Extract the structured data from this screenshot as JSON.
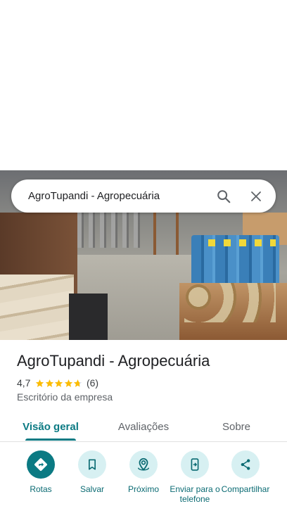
{
  "search": {
    "query": "AgroTupandi - Agropecuária"
  },
  "place": {
    "name": "AgroTupandi - Agropecuária",
    "rating": "4,7",
    "rating_value": 4.7,
    "review_count": "(6)",
    "category": "Escritório da empresa"
  },
  "tabs": [
    {
      "label": "Visão geral",
      "active": true
    },
    {
      "label": "Avaliações",
      "active": false
    },
    {
      "label": "Sobre",
      "active": false
    }
  ],
  "actions": [
    {
      "label": "Rotas",
      "icon": "directions-icon"
    },
    {
      "label": "Salvar",
      "icon": "bookmark-icon"
    },
    {
      "label": "Próximo",
      "icon": "nearby-icon"
    },
    {
      "label": "Enviar para o telefone",
      "icon": "send-to-phone-icon"
    },
    {
      "label": "Compartilhar",
      "icon": "share-icon"
    }
  ],
  "colors": {
    "accent": "#0b7a83",
    "star": "#fbbc04",
    "chip_bg": "#d7f0f2"
  }
}
